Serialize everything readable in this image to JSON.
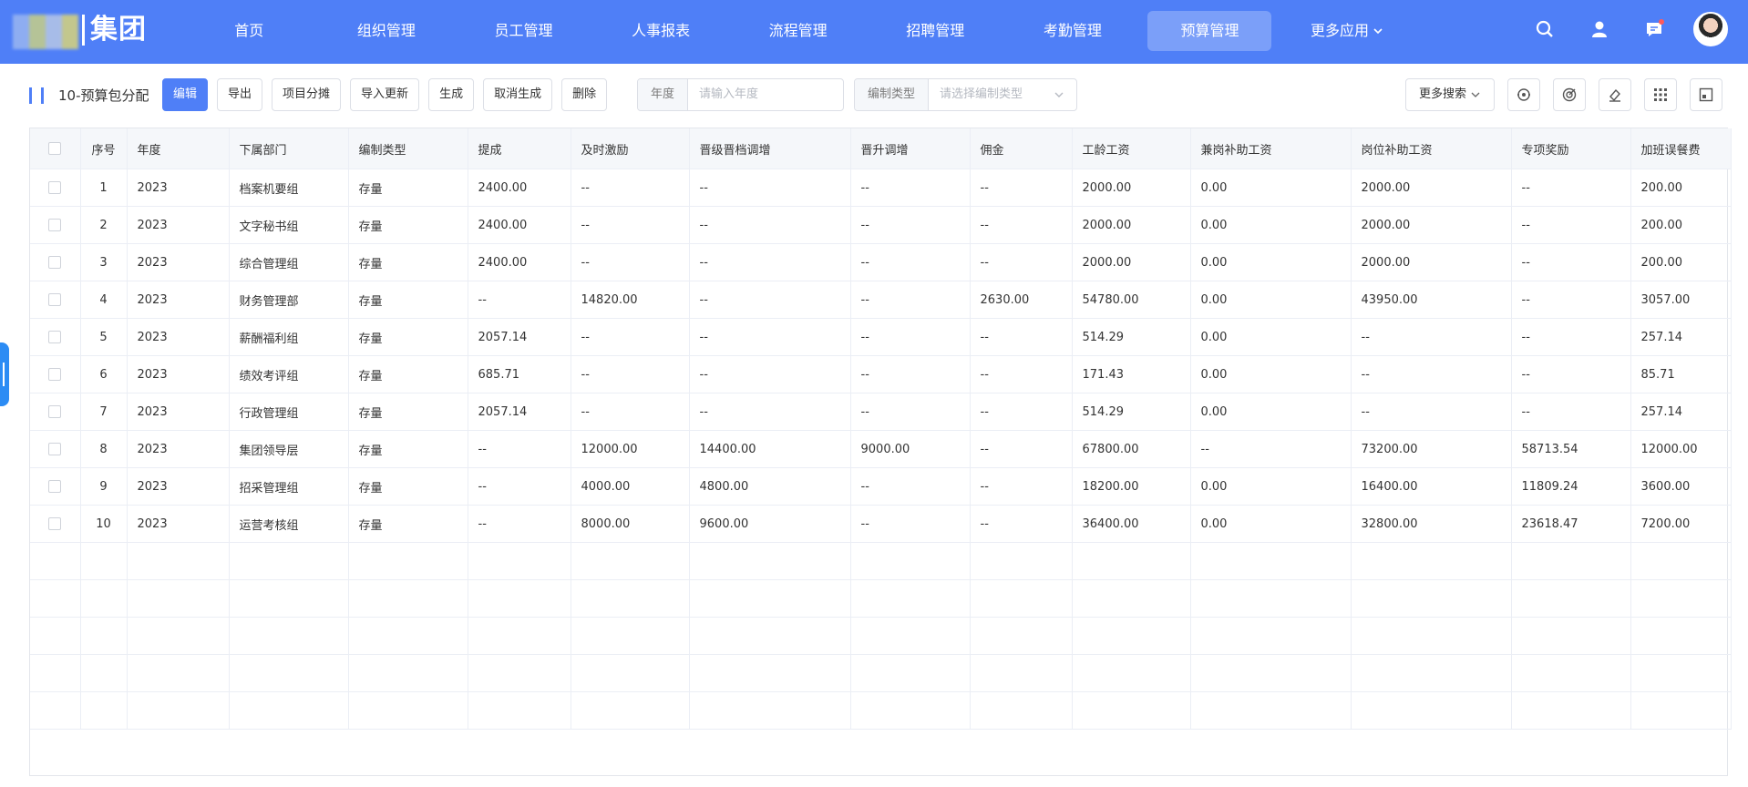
{
  "header": {
    "logo_text": "集团",
    "nav": [
      "首页",
      "组织管理",
      "员工管理",
      "人事报表",
      "流程管理",
      "招聘管理",
      "考勤管理",
      "预算管理"
    ],
    "active_nav": "预算管理",
    "more_apps": "更多应用"
  },
  "toolbar": {
    "title": "10-预算包分配",
    "buttons": [
      "编辑",
      "导出",
      "项目分摊",
      "导入更新",
      "生成",
      "取消生成",
      "删除"
    ],
    "year_label": "年度",
    "year_placeholder": "请输入年度",
    "type_label": "编制类型",
    "type_placeholder": "请选择编制类型",
    "more_search": "更多搜索"
  },
  "table": {
    "columns": [
      "序号",
      "年度",
      "下属部门",
      "编制类型",
      "提成",
      "及时激励",
      "晋级晋档调增",
      "晋升调增",
      "佣金",
      "工龄工资",
      "兼岗补助工资",
      "岗位补助工资",
      "专项奖励",
      "加班误餐费"
    ],
    "rows": [
      [
        "1",
        "2023",
        "档案机要组",
        "存量",
        "2400.00",
        "--",
        "--",
        "--",
        "--",
        "2000.00",
        "0.00",
        "2000.00",
        "--",
        "200.00"
      ],
      [
        "2",
        "2023",
        "文字秘书组",
        "存量",
        "2400.00",
        "--",
        "--",
        "--",
        "--",
        "2000.00",
        "0.00",
        "2000.00",
        "--",
        "200.00"
      ],
      [
        "3",
        "2023",
        "综合管理组",
        "存量",
        "2400.00",
        "--",
        "--",
        "--",
        "--",
        "2000.00",
        "0.00",
        "2000.00",
        "--",
        "200.00"
      ],
      [
        "4",
        "2023",
        "财务管理部",
        "存量",
        "--",
        "14820.00",
        "--",
        "--",
        "2630.00",
        "54780.00",
        "0.00",
        "43950.00",
        "--",
        "3057.00"
      ],
      [
        "5",
        "2023",
        "薪酬福利组",
        "存量",
        "2057.14",
        "--",
        "--",
        "--",
        "--",
        "514.29",
        "0.00",
        "--",
        "--",
        "257.14"
      ],
      [
        "6",
        "2023",
        "绩效考评组",
        "存量",
        "685.71",
        "--",
        "--",
        "--",
        "--",
        "171.43",
        "0.00",
        "--",
        "--",
        "85.71"
      ],
      [
        "7",
        "2023",
        "行政管理组",
        "存量",
        "2057.14",
        "--",
        "--",
        "--",
        "--",
        "514.29",
        "0.00",
        "--",
        "--",
        "257.14"
      ],
      [
        "8",
        "2023",
        "集团领导层",
        "存量",
        "--",
        "12000.00",
        "14400.00",
        "9000.00",
        "--",
        "67800.00",
        "--",
        "73200.00",
        "58713.54",
        "12000.00"
      ],
      [
        "9",
        "2023",
        "招采管理组",
        "存量",
        "--",
        "4000.00",
        "4800.00",
        "--",
        "--",
        "18200.00",
        "0.00",
        "16400.00",
        "11809.24",
        "3600.00"
      ],
      [
        "10",
        "2023",
        "运营考核组",
        "存量",
        "--",
        "8000.00",
        "9600.00",
        "--",
        "--",
        "36400.00",
        "0.00",
        "32800.00",
        "23618.47",
        "7200.00"
      ]
    ]
  }
}
